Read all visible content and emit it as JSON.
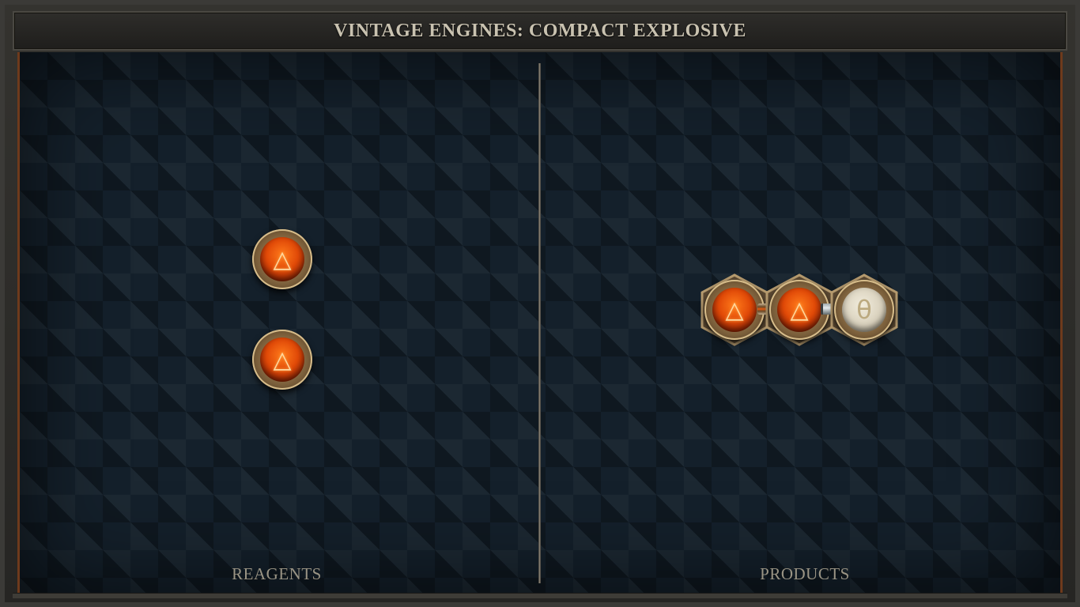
{
  "header": {
    "title": "VINTAGE ENGINES: COMPACT EXPLOSIVE"
  },
  "panels": {
    "reagents_label": "REAGENTS",
    "products_label": "PRODUCTS"
  },
  "reagents": [
    {
      "element": "fire",
      "glyph": "△"
    },
    {
      "element": "fire",
      "glyph": "△"
    }
  ],
  "product": {
    "atoms": [
      {
        "element": "fire",
        "glyph": "△"
      },
      {
        "element": "fire",
        "glyph": "△"
      },
      {
        "element": "salt",
        "glyph": "θ"
      }
    ],
    "bonds": [
      "triplex",
      "normal"
    ]
  },
  "colors": {
    "fire": "#e14a08",
    "salt": "#d9d1bd",
    "board": "#14202b",
    "frame_trim": "#6e3a1c"
  }
}
